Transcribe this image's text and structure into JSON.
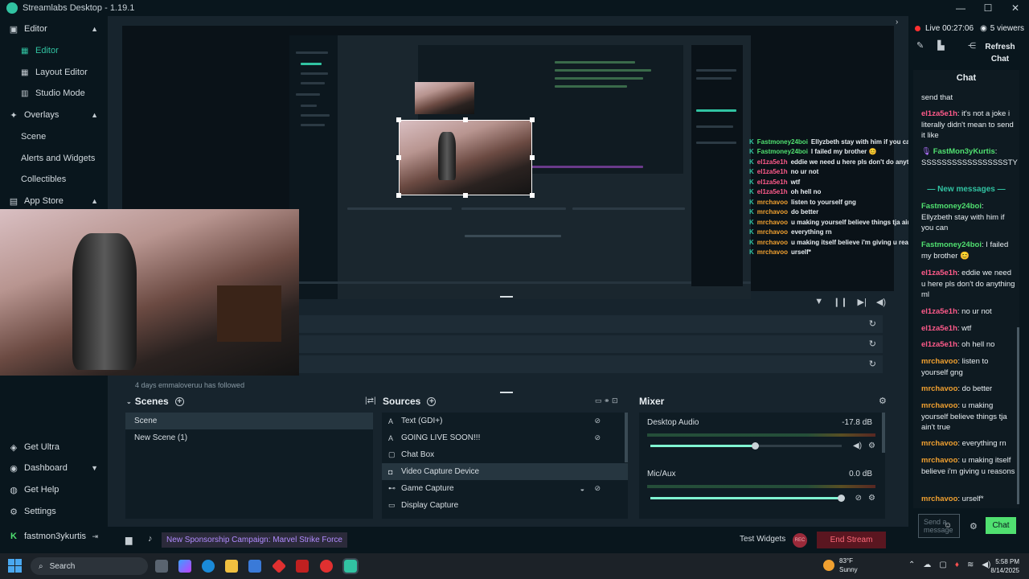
{
  "window": {
    "title": "Streamlabs Desktop - 1.19.1",
    "controls": [
      "—",
      "☐",
      "✕"
    ]
  },
  "nav": {
    "editor": "Editor",
    "editor_sub": [
      "Editor",
      "Layout Editor",
      "Studio Mode"
    ],
    "overlays": "Overlays",
    "overlays_sub": [
      "Scene",
      "Alerts and Widgets",
      "Collectibles"
    ],
    "app_store": "App Store",
    "get_ultra": "Get Ultra",
    "dashboard": "Dashboard",
    "get_help": "Get Help",
    "settings": "Settings",
    "user": "fastmon3ykurtis"
  },
  "overlay_chat": [
    {
      "user": "Fastmoney24boi",
      "text": "Ellyzbeth stay with him if you can"
    },
    {
      "user": "Fastmoney24boi",
      "text": "I failed my brother 😊"
    },
    {
      "user": "el1za5e1h",
      "text": "eddie we need u here pls don't do anything ml"
    },
    {
      "user": "el1za5e1h",
      "text": "no ur not"
    },
    {
      "user": "el1za5e1h",
      "text": "wtf"
    },
    {
      "user": "el1za5e1h",
      "text": "oh hell no"
    },
    {
      "user": "mrchavoo",
      "text": "listen to yourself gng"
    },
    {
      "user": "mrchavoo",
      "text": "do better"
    },
    {
      "user": "mrchavoo",
      "text": "u making yourself believe things tja ain't true"
    },
    {
      "user": "mrchavoo",
      "text": "everything rn"
    },
    {
      "user": "mrchavoo",
      "text": "u making itself believe i'm giving u reasons"
    },
    {
      "user": "mrchavoo",
      "text": "urself*"
    }
  ],
  "events": {
    "partial_text": "4 days  emmaloveruu  has followed"
  },
  "scenes": {
    "title": "Scenes",
    "items": [
      "Scene",
      "New Scene (1)"
    ]
  },
  "sources": {
    "title": "Sources",
    "items": [
      "Text (GDI+)",
      "GOING LIVE SOON!!!",
      "Chat Box",
      "Video Capture Device",
      "Game Capture",
      "Display Capture"
    ]
  },
  "mixer": {
    "title": "Mixer",
    "channels": [
      {
        "name": "Desktop Audio",
        "db": "-17.8 dB",
        "level": 0.55
      },
      {
        "name": "Mic/Aux",
        "db": "0.0 dB",
        "level": 1.0
      }
    ]
  },
  "footer": {
    "promo": "New Sponsorship Campaign: Marvel Strike Force",
    "test_widgets": "Test Widgets",
    "rec": "REC",
    "end_stream": "End Stream"
  },
  "chat": {
    "live": "Live 00:27:06",
    "viewers": "5 viewers",
    "refresh": "Refresh Chat",
    "title": "Chat",
    "new_messages": "New messages",
    "input_placeholder": "Send a message",
    "send": "Chat",
    "colors": {
      "green": "#50e070",
      "pink": "#ff5a8a",
      "orange": "#f0a030",
      "purple": "#b070ff"
    },
    "messages": [
      {
        "user": "",
        "text": "send that",
        "color": ""
      },
      {
        "user": "el1za5e1h",
        "text": ": it's not a joke i literally didn't mean to send it like",
        "color": "pink"
      },
      {
        "user": "FastMon3yKurtis",
        "text": ": SSSSSSSSSSSSSSSSSTY",
        "color": "purple"
      },
      {
        "user": "Fastmoney24boi",
        "text": ": Ellyzbeth stay with him if you can",
        "color": "green"
      },
      {
        "user": "Fastmoney24boi",
        "text": ": I failed my brother 😊",
        "color": "green"
      },
      {
        "user": "el1za5e1h",
        "text": ": eddie we need u here pls don't do anything ml",
        "color": "pink"
      },
      {
        "user": "el1za5e1h",
        "text": ": no ur not",
        "color": "pink"
      },
      {
        "user": "el1za5e1h",
        "text": ": wtf",
        "color": "pink"
      },
      {
        "user": "el1za5e1h",
        "text": ": oh hell no",
        "color": "pink"
      },
      {
        "user": "mrchavoo",
        "text": ": listen to yourself gng",
        "color": "orange"
      },
      {
        "user": "mrchavoo",
        "text": ": do better",
        "color": "orange"
      },
      {
        "user": "mrchavoo",
        "text": ": u making yourself believe things tja ain't true",
        "color": "orange"
      },
      {
        "user": "mrchavoo",
        "text": ": everything rn",
        "color": "orange"
      },
      {
        "user": "mrchavoo",
        "text": ": u making itself believe i'm giving u reasons",
        "color": "orange"
      },
      {
        "user": "mrchavoo",
        "text": ": urself*",
        "color": "orange"
      }
    ]
  },
  "taskbar": {
    "search": "Search",
    "weather_temp": "83°F",
    "weather_desc": "Sunny",
    "time": "5:58 PM",
    "date": "8/14/2025"
  }
}
